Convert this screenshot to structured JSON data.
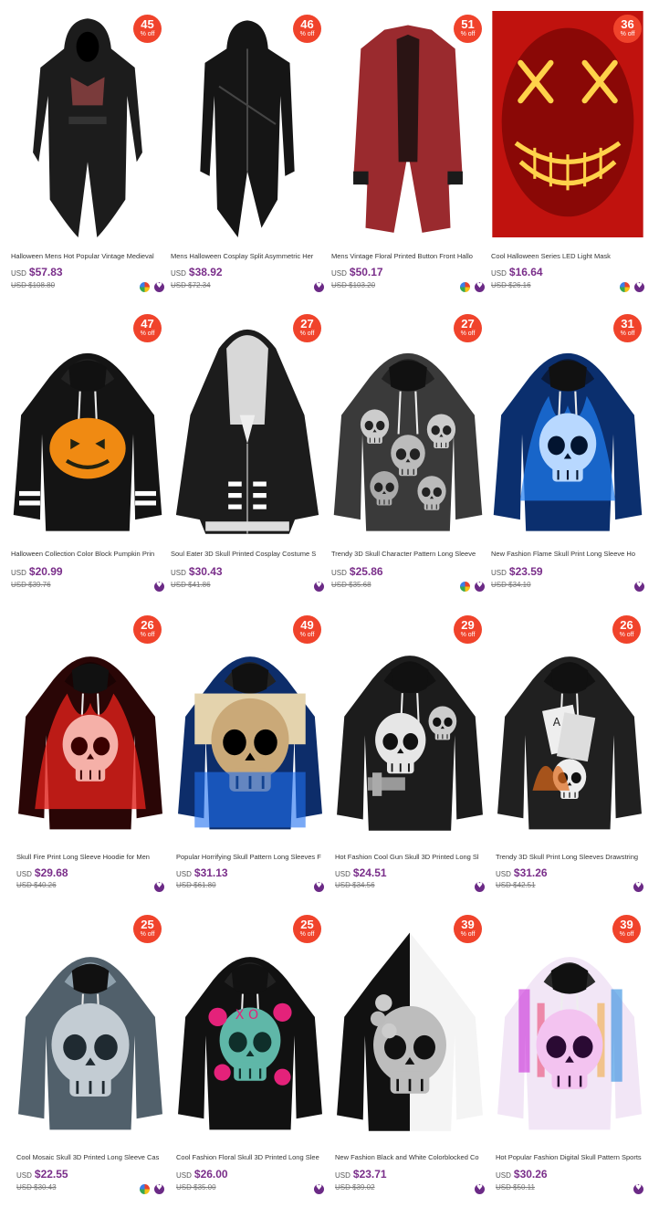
{
  "products": [
    {
      "title": "Halloween Mens Hot Popular Vintage Medieval",
      "currency": "USD",
      "price": "$57.83",
      "old_price": "USD $108.80",
      "discount": "45",
      "off_label": "% off",
      "color_icon": true,
      "image": "black-hooded-tailcoat"
    },
    {
      "title": "Mens Halloween Cosplay Split Asymmetric Her",
      "currency": "USD",
      "price": "$38.92",
      "old_price": "USD $72.34",
      "discount": "46",
      "off_label": "% off",
      "color_icon": false,
      "image": "black-asymmetric-coat"
    },
    {
      "title": "Mens Vintage Floral Printed Button Front Hallo",
      "currency": "USD",
      "price": "$50.17",
      "old_price": "USD $103.20",
      "discount": "51",
      "off_label": "% off",
      "color_icon": true,
      "image": "red-floral-tailcoat"
    },
    {
      "title": "Cool Halloween Series LED Light Mask",
      "currency": "USD",
      "price": "$16.64",
      "old_price": "USD $26.16",
      "discount": "36",
      "off_label": "% off",
      "color_icon": true,
      "image": "led-mask"
    },
    {
      "title": "Halloween Collection Color Block Pumpkin Prin",
      "currency": "USD",
      "price": "$20.99",
      "old_price": "USD $39.76",
      "discount": "47",
      "off_label": "% off",
      "color_icon": false,
      "image": "pumpkin-hoodie"
    },
    {
      "title": "Soul Eater 3D Skull Printed Cosplay Costume S",
      "currency": "USD",
      "price": "$30.43",
      "old_price": "USD $41.86",
      "discount": "27",
      "off_label": "% off",
      "color_icon": false,
      "image": "soul-eater-jacket"
    },
    {
      "title": "Trendy 3D Skull Character Pattern Long Sleeve",
      "currency": "USD",
      "price": "$25.86",
      "old_price": "USD $35.68",
      "discount": "27",
      "off_label": "% off",
      "color_icon": true,
      "image": "character-hoodie"
    },
    {
      "title": "New Fashion Flame Skull Print Long Sleeve Ho",
      "currency": "USD",
      "price": "$23.59",
      "old_price": "USD $34.10",
      "discount": "31",
      "off_label": "% off",
      "color_icon": false,
      "image": "blue-flame-skull-hoodie"
    },
    {
      "title": "Skull Fire Print Long Sleeve Hoodie for Men",
      "currency": "USD",
      "price": "$29.68",
      "old_price": "USD $40.26",
      "discount": "26",
      "off_label": "% off",
      "color_icon": false,
      "image": "red-fire-skull-hoodie"
    },
    {
      "title": "Popular Horrifying Skull Pattern Long Sleeves F",
      "currency": "USD",
      "price": "$31.13",
      "old_price": "USD $61.80",
      "discount": "49",
      "off_label": "% off",
      "color_icon": false,
      "image": "blue-skull-hoodie"
    },
    {
      "title": "Hot Fashion Cool Gun Skull 3D Printed Long Sl",
      "currency": "USD",
      "price": "$24.51",
      "old_price": "USD $34.56",
      "discount": "29",
      "off_label": "% off",
      "color_icon": false,
      "image": "gun-skull-hoodie"
    },
    {
      "title": "Trendy 3D Skull Print Long Sleeves Drawstring",
      "currency": "USD",
      "price": "$31.26",
      "old_price": "USD $42.51",
      "discount": "26",
      "off_label": "% off",
      "color_icon": false,
      "image": "card-skull-hoodie"
    },
    {
      "title": "Cool Mosaic Skull 3D Printed Long Sleeve Cas",
      "currency": "USD",
      "price": "$22.55",
      "old_price": "USD $30.43",
      "discount": "25",
      "off_label": "% off",
      "color_icon": true,
      "image": "mosaic-skull-hoodie"
    },
    {
      "title": "Cool Fashion Floral Skull 3D Printed Long Slee",
      "currency": "USD",
      "price": "$26.00",
      "old_price": "USD $35.00",
      "discount": "25",
      "off_label": "% off",
      "color_icon": false,
      "image": "floral-skull-hoodie"
    },
    {
      "title": "New Fashion Black and White Colorblocked Co",
      "currency": "USD",
      "price": "$23.71",
      "old_price": "USD $39.02",
      "discount": "39",
      "off_label": "% off",
      "color_icon": false,
      "image": "black-white-skull-hoodie"
    },
    {
      "title": "Hot Popular Fashion Digital Skull Pattern Sports",
      "currency": "USD",
      "price": "$30.26",
      "old_price": "USD $50.11",
      "discount": "39",
      "off_label": "% off",
      "color_icon": false,
      "image": "digital-skull-hoodie"
    }
  ],
  "colors": {
    "badge": "#f0432b",
    "price": "#7a2e8a",
    "fav_icon": "#6b2a86"
  }
}
